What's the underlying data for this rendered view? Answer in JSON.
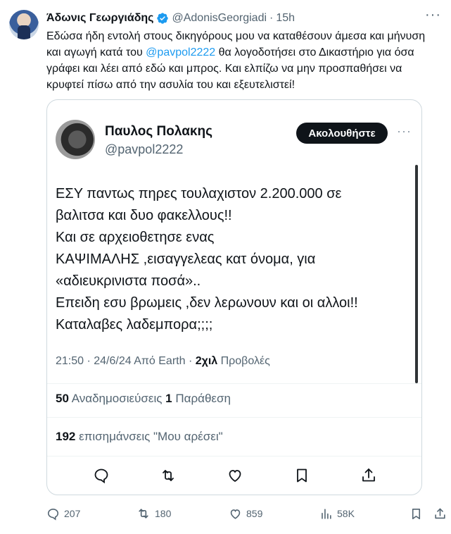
{
  "author": {
    "display_name": "Άδωνις Γεωργιάδης",
    "handle": "@AdonisGeorgiadi",
    "separator": "·",
    "time": "15h",
    "verified": true
  },
  "tweet": {
    "text_before_mention": "Εδώσα ήδη εντολή στους δικηγόρους μου να καταθέσουν άμεσα και μήνυση και αγωγή κατά του ",
    "mention": "@pavpol2222",
    "text_after_mention": " θα λογοδοτήσει στο Δικαστήριο για όσα γράφει και λέει από εδώ και μπρος. Και ελπίζω να μην προσπαθήσει να κρυφτεί πίσω από την ασυλία του και εξευτελιστεί!"
  },
  "quote": {
    "display_name": "Παυλος Πολακης",
    "handle": "@pavpol2222",
    "follow_label": "Ακολουθήστε",
    "lines": [
      "ΕΣΥ παντως  πηρες τουλαχιστον 2.200.000 σε",
      "βαλιτσα και δυο φακελλους!!",
      "Και σε αρχειοθετησε ενας",
      "ΚΑΨΙΜΑΛΗΣ ,εισαγγελεας κατ όνομα, για",
      "«αδιευκρινιστα ποσά»..",
      "Επειδη εσυ βρωμεις ,δεν λερωνουν και οι αλλοι!!",
      "Καταλαβες λαδεμπορα;;;;"
    ],
    "meta_time": "21:50 · 24/6/24 Από Earth · ",
    "views_count": "2χιλ",
    "views_label": " Προβολές",
    "reposts_count": "50",
    "reposts_label": " Αναδημοσιεύσεις ",
    "quotes_count": "1",
    "quotes_label": " Παράθεση",
    "likes_count": "192",
    "likes_label": " επισημάνσεις \"Μου αρέσει\""
  },
  "actions": {
    "replies": "207",
    "retweets": "180",
    "likes": "859",
    "views": "58K"
  },
  "colors": {
    "accent": "#1d9bf0",
    "text": "#0f1419",
    "muted": "#536471",
    "border": "#cfd9de"
  }
}
